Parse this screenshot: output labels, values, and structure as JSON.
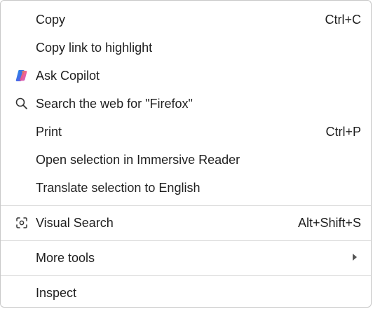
{
  "menu": {
    "items": [
      {
        "label": "Copy",
        "shortcut": "Ctrl+C"
      },
      {
        "label": "Copy link to highlight",
        "shortcut": ""
      },
      {
        "label": "Ask Copilot",
        "shortcut": "",
        "icon": "copilot-icon"
      },
      {
        "label": "Search the web for \"Firefox\"",
        "shortcut": "",
        "icon": "search-icon"
      },
      {
        "label": "Print",
        "shortcut": "Ctrl+P"
      },
      {
        "label": "Open selection in Immersive Reader",
        "shortcut": ""
      },
      {
        "label": "Translate selection to English",
        "shortcut": ""
      }
    ],
    "visual_search": {
      "label": "Visual Search",
      "shortcut": "Alt+Shift+S",
      "icon": "visual-search-icon"
    },
    "more_tools": {
      "label": "More tools",
      "icon": "chevron-right-icon"
    },
    "inspect": {
      "label": "Inspect"
    }
  },
  "colors": {
    "text": "#1f1f1f",
    "border": "#c8c8c8",
    "divider": "#dcdcdc",
    "background": "#ffffff"
  }
}
